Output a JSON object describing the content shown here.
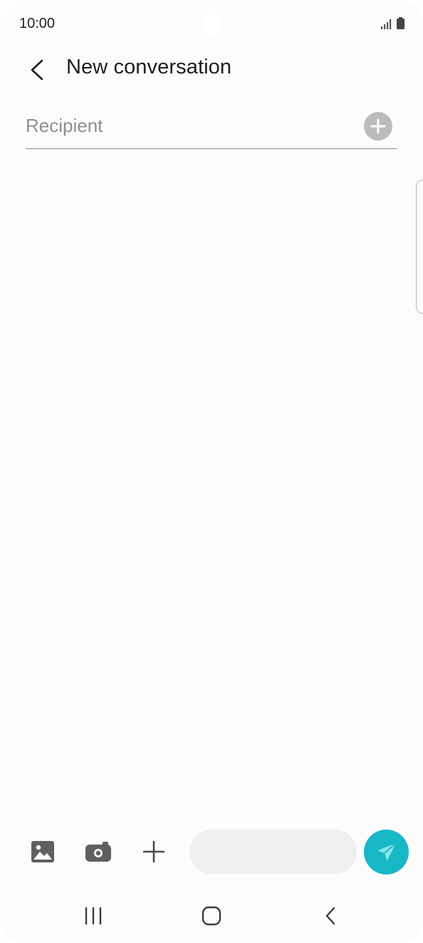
{
  "status_bar": {
    "time": "10:00",
    "signal_icon": "signal-icon",
    "battery_icon": "battery-icon"
  },
  "header": {
    "back_icon": "back-arrow-icon",
    "title": "New conversation"
  },
  "recipient": {
    "placeholder": "Recipient",
    "value": "",
    "add_icon": "plus-circle-icon"
  },
  "compose": {
    "gallery_icon": "image-icon",
    "camera_icon": "camera-icon",
    "more_icon": "plus-icon",
    "message_value": "",
    "send_icon": "send-icon"
  },
  "nav_bar": {
    "recents_icon": "recents-icon",
    "home_icon": "home-icon",
    "back_icon": "back-icon"
  },
  "colors": {
    "background": "#fcfcfc",
    "accent": "#18b7c5",
    "field_fill": "#efefef",
    "icon_gray": "#5f5f5f",
    "divider": "#8c8c8c"
  }
}
